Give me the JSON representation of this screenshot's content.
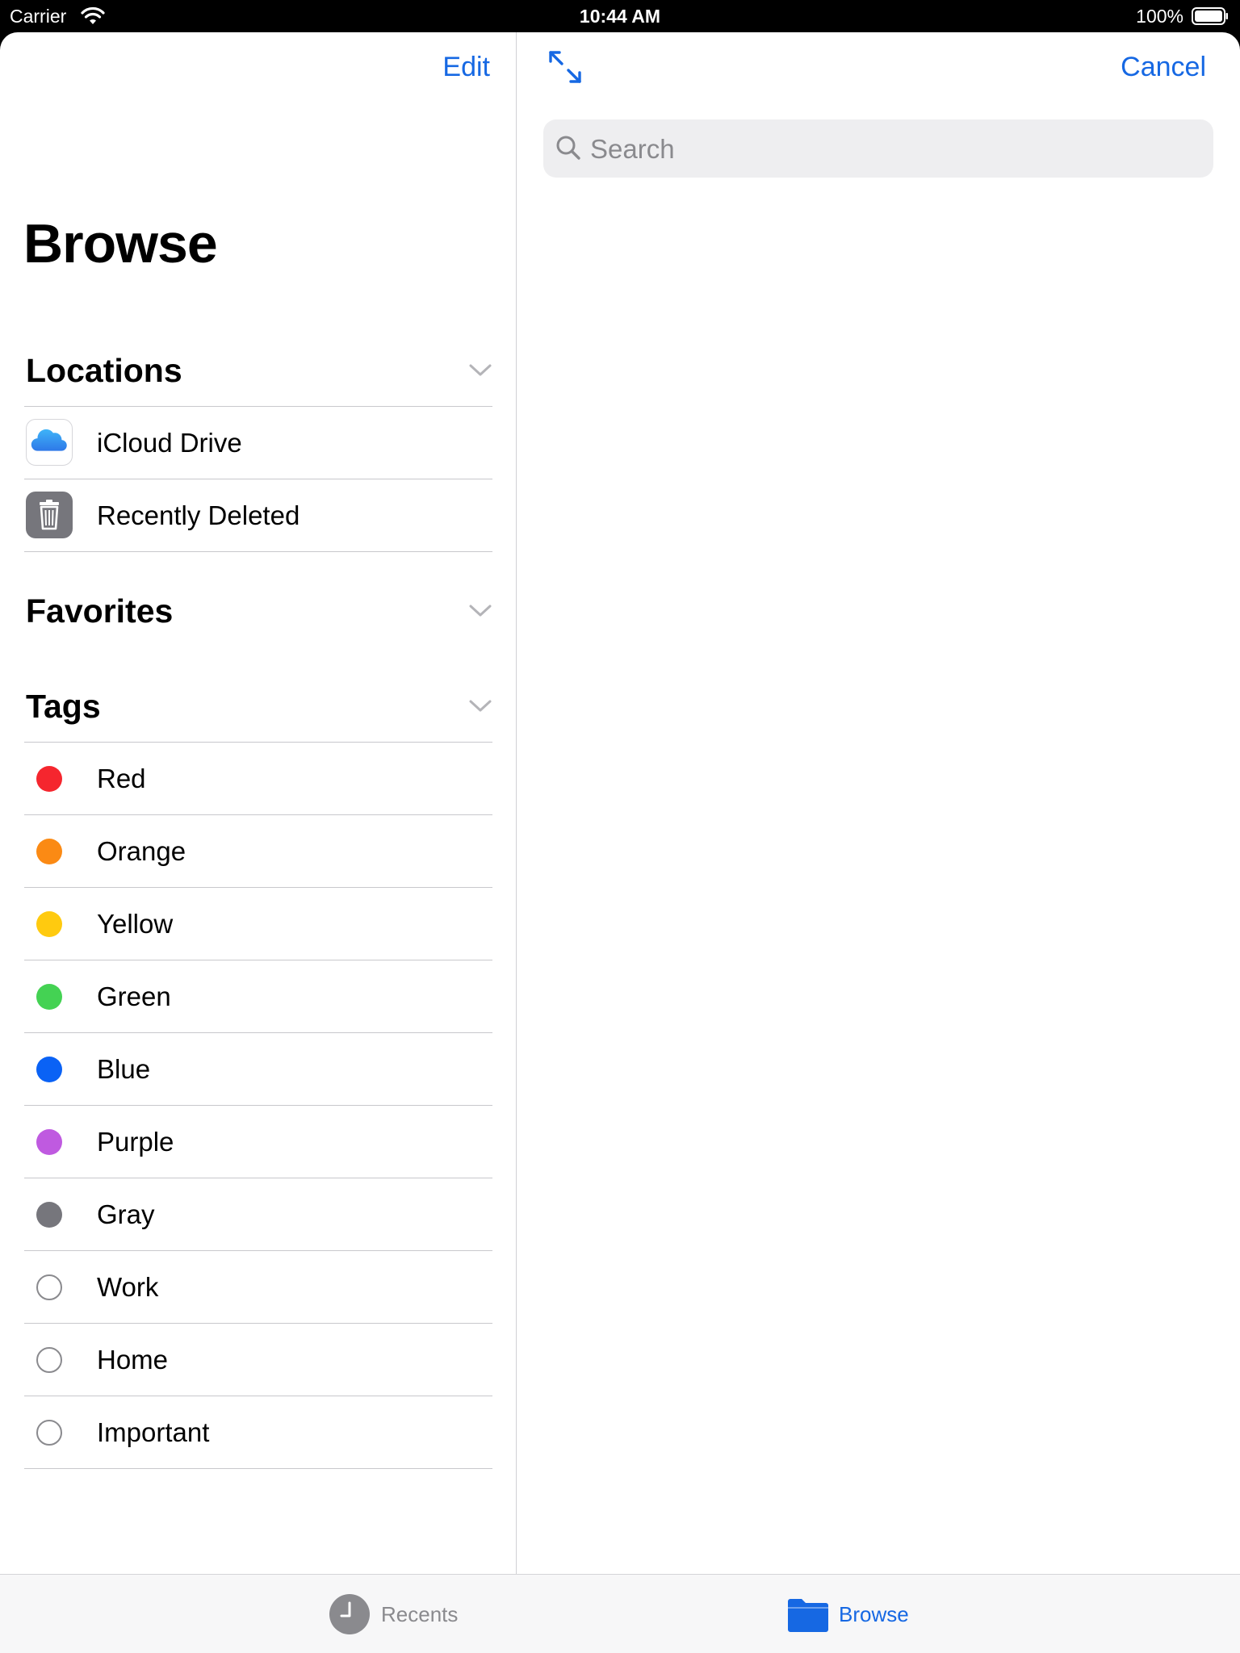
{
  "status_bar": {
    "carrier": "Carrier",
    "time": "10:44 AM",
    "battery": "100%"
  },
  "sidebar": {
    "edit_label": "Edit",
    "title": "Browse",
    "sections": {
      "locations": "Locations",
      "favorites": "Favorites",
      "tags": "Tags"
    },
    "locations": [
      {
        "label": "iCloud Drive",
        "icon": "icloud-icon"
      },
      {
        "label": "Recently Deleted",
        "icon": "trash-icon"
      }
    ],
    "tags": [
      {
        "label": "Red",
        "color": "#F5262E"
      },
      {
        "label": "Orange",
        "color": "#FB8A14"
      },
      {
        "label": "Yellow",
        "color": "#FFCA0F"
      },
      {
        "label": "Green",
        "color": "#44D253"
      },
      {
        "label": "Blue",
        "color": "#0A62F5"
      },
      {
        "label": "Purple",
        "color": "#BF5AE0"
      },
      {
        "label": "Gray",
        "color": "#76767C"
      },
      {
        "label": "Work",
        "color": ""
      },
      {
        "label": "Home",
        "color": ""
      },
      {
        "label": "Important",
        "color": ""
      }
    ]
  },
  "detail": {
    "cancel_label": "Cancel",
    "search_placeholder": "Search"
  },
  "tabbar": {
    "recents_label": "Recents",
    "browse_label": "Browse",
    "active_color": "#1668E3",
    "inactive_color": "#8A8A8E"
  }
}
